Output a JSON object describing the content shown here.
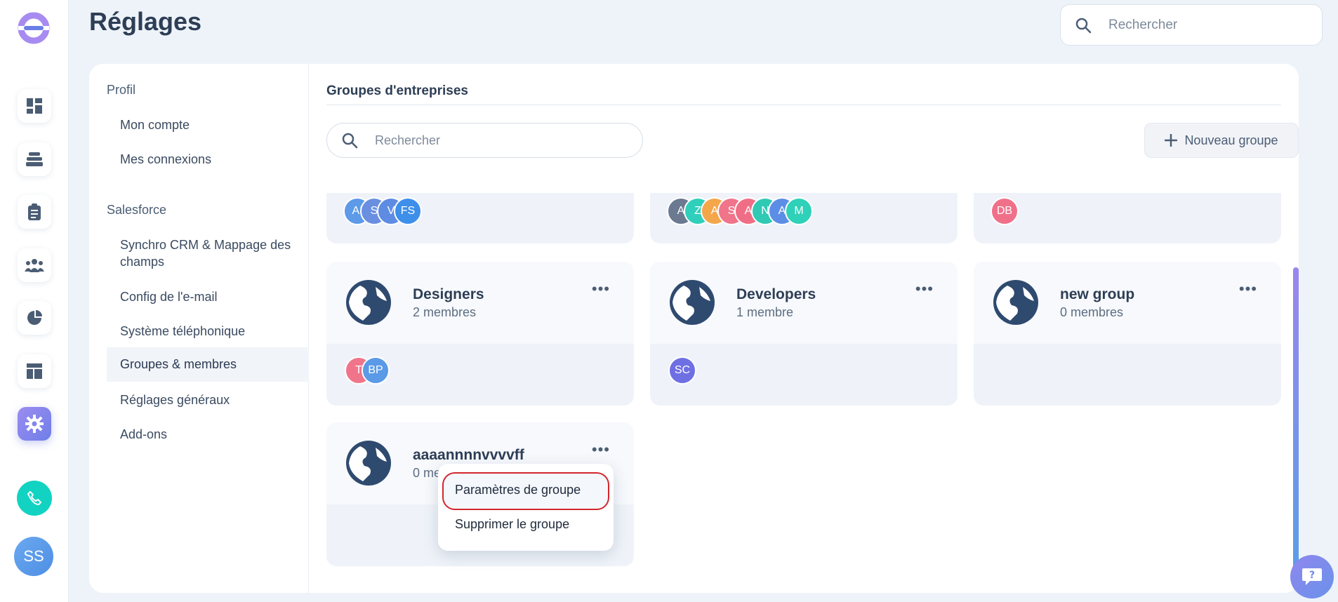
{
  "app": {
    "page_title": "Réglages",
    "top_search_placeholder": "Rechercher",
    "user_initials": "SS"
  },
  "settings_nav": {
    "section_profile": "Profil",
    "profile_items": [
      "Mon compte",
      "Mes connexions"
    ],
    "section_salesforce": "Salesforce",
    "salesforce_items": [
      "Synchro CRM & Mappage des champs",
      "Config de l'e-mail",
      "Système téléphonique",
      "Groupes & membres",
      "Réglages généraux",
      "Add-ons"
    ],
    "active_item": "Groupes & membres"
  },
  "content": {
    "title": "Groupes d'entreprises",
    "search_placeholder": "Rechercher",
    "new_group_label": "Nouveau groupe"
  },
  "partial_cards": [
    {
      "avatars": [
        "AI",
        "S",
        "V",
        "FS"
      ]
    },
    {
      "avatars": [
        "A",
        "Z",
        "A",
        "S",
        "A",
        "N",
        "A",
        "M"
      ]
    },
    {
      "avatars": [
        "DB"
      ]
    }
  ],
  "groups": [
    {
      "name": "Designers",
      "count": "2 membres",
      "avatars": [
        "T",
        "BP"
      ]
    },
    {
      "name": "Developers",
      "count": "1 membre",
      "avatars": [
        "SC"
      ]
    },
    {
      "name": "new group",
      "count": "0 membres",
      "avatars": []
    },
    {
      "name": "aaaannnnvvvvff",
      "count": "0 me",
      "avatars": []
    }
  ],
  "context_menu": {
    "items": [
      "Paramètres de groupe",
      "Supprimer le groupe"
    ]
  },
  "colors": {
    "accent": "#7f87ec",
    "highlight_border": "#d4262e",
    "phone": "#12d3c2",
    "globe": "#2f4a6f"
  },
  "icons": {
    "logo": "ring-logo-icon",
    "nav": [
      "dashboard-icon",
      "stack-icon",
      "clipboard-icon",
      "team-icon",
      "pie-chart-icon",
      "layout-icon",
      "gear-icon"
    ],
    "search": "search-icon",
    "plus": "plus-icon",
    "globe": "globe-icon",
    "more": "more-dots-icon",
    "phone": "phone-icon",
    "help": "help-chat-icon"
  }
}
